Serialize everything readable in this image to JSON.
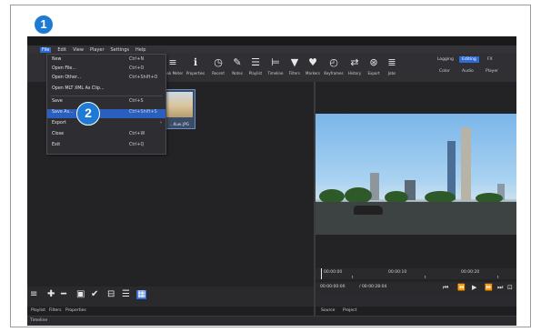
{
  "menubar": {
    "items": [
      "File",
      "Edit",
      "View",
      "Player",
      "Settings",
      "Help"
    ]
  },
  "toolbar": {
    "items": [
      {
        "label": "Peak Meter",
        "icon": "meter-icon"
      },
      {
        "label": "Properties",
        "icon": "info-icon"
      },
      {
        "label": "Recent",
        "icon": "clock-icon"
      },
      {
        "label": "Notes",
        "icon": "notes-icon"
      },
      {
        "label": "Playlist",
        "icon": "playlist-icon"
      },
      {
        "label": "Timeline",
        "icon": "timeline-icon"
      },
      {
        "label": "Filters",
        "icon": "filter-icon"
      },
      {
        "label": "Markers",
        "icon": "marker-icon"
      },
      {
        "label": "Keyframes",
        "icon": "keyframe-icon"
      },
      {
        "label": "History",
        "icon": "history-icon"
      },
      {
        "label": "Export",
        "icon": "export-icon"
      },
      {
        "label": "Jobs",
        "icon": "jobs-icon"
      }
    ],
    "layouts": [
      "Logging",
      "Editing",
      "FX"
    ],
    "layout_selected": "Editing",
    "layouts_sub": [
      "Color",
      "Audio",
      "Player"
    ]
  },
  "file_menu": {
    "items": [
      {
        "label": "New",
        "shortcut": "Ctrl+N"
      },
      {
        "label": "Open File...",
        "shortcut": "Ctrl+O"
      },
      {
        "label": "Open Other...",
        "shortcut": "Ctrl+Shift+O"
      },
      {
        "label": "Open MLT XML As Clip...",
        "shortcut": ""
      },
      {
        "label": "Save",
        "shortcut": "Ctrl+S"
      },
      {
        "label": "Save As...",
        "shortcut": "Ctrl+Shift+S"
      },
      {
        "label": "Export",
        "shortcut": ""
      },
      {
        "label": "Close",
        "shortcut": "Ctrl+W"
      },
      {
        "label": "Exit",
        "shortcut": "Ctrl+Q"
      }
    ]
  },
  "clip": {
    "caption": "...Kuw..JPG"
  },
  "player": {
    "ruler": [
      "00:00:00",
      "00:00:10",
      "00:00:20"
    ],
    "timecode": "00:00:00:00",
    "duration": "/ 00:00:28:04"
  },
  "tabs_left": [
    "Playlist",
    "Filters",
    "Properties"
  ],
  "tabs_right": [
    "Source",
    "Project"
  ],
  "timeline_label": "Timeline",
  "badges": {
    "step1": "1",
    "step2": "2"
  },
  "colors": {
    "accent": "#2f6bd6",
    "badge": "#1f7ad4",
    "background": "#2b2b2f"
  }
}
